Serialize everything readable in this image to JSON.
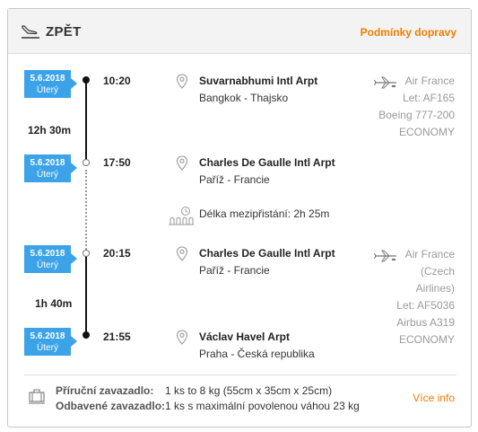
{
  "header": {
    "title": "ZPĚT",
    "conditions_link": "Podmínky dopravy",
    "icon": "landing-plane-icon"
  },
  "segments": [
    {
      "date": "5.6.2018",
      "weekday": "Úterý",
      "time": "10:20",
      "airport": "Suvarnabhumi Intl Arpt",
      "city": "Bangkok - Thajsko"
    },
    {
      "date": "5.6.2018",
      "weekday": "Úterý",
      "time": "17:50",
      "airport": "Charles De Gaulle Intl Arpt",
      "city": "Paříž - Francie"
    },
    {
      "date": "5.6.2018",
      "weekday": "Úterý",
      "time": "20:15",
      "airport": "Charles De Gaulle Intl Arpt",
      "city": "Paříž - Francie"
    },
    {
      "date": "5.6.2018",
      "weekday": "Úterý",
      "time": "21:55",
      "airport": "Václav Havel Arpt",
      "city": "Praha - Česká republika"
    }
  ],
  "flights": [
    {
      "duration": "12h 30m",
      "airline_lines": [
        "Air France",
        "Let: AF165",
        "Boeing 777-200",
        "ECONOMY"
      ]
    },
    {
      "duration": "1h 40m",
      "airline_lines": [
        "Air France",
        "(Czech",
        "Airlines)",
        "Let: AF5036",
        "Airbus A319",
        "ECONOMY"
      ]
    }
  ],
  "layover": {
    "text": "Délka mezipřistání: 2h 25m"
  },
  "baggage": {
    "carry_on_label": "Příruční zavazadlo:",
    "carry_on_value": "1 ks to 8 kg (55cm x 35cm x 25cm)",
    "checked_label": "Odbavené zavazadlo:",
    "checked_value": "1 ks s maximální povolenou váhou 23 kg",
    "more_info": "Více info"
  },
  "colors": {
    "accent": "#f07d00",
    "badge": "#3da3e8"
  }
}
